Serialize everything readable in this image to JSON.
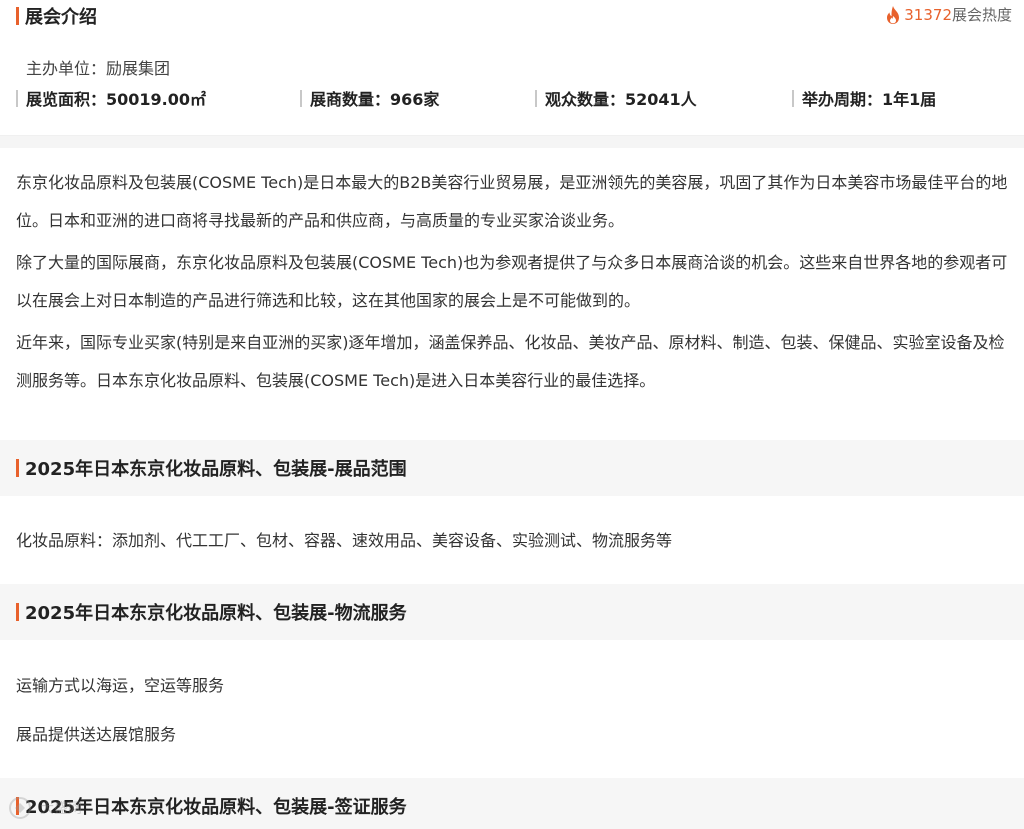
{
  "intro": {
    "title": "展会介绍",
    "heat_value": "31372",
    "heat_label": "展会热度",
    "organizer": "主办单位：励展集团",
    "stats": [
      {
        "label": "展览面积：50019.00㎡"
      },
      {
        "label": "展商数量：966家"
      },
      {
        "label": "观众数量：52041人"
      },
      {
        "label": "举办周期：1年1届"
      }
    ]
  },
  "paragraphs": [
    "东京化妆品原料及包装展(COSME Tech)是日本最大的B2B美容行业贸易展，是亚洲领先的美容展，巩固了其作为日本美容市场最佳平台的地位。日本和亚洲的进口商将寻找最新的产品和供应商，与高质量的专业买家洽谈业务。",
    "除了大量的国际展商，东京化妆品原料及包装展(COSME Tech)也为参观者提供了与众多日本展商洽谈的机会。这些来自世界各地的参观者可以在展会上对日本制造的产品进行筛选和比较，这在其他国家的展会上是不可能做到的。",
    "近年来，国际专业买家(特别是来自亚洲的买家)逐年增加，涵盖保养品、化妆品、美妆产品、原材料、制造、包装、保健品、实验室设备及检测服务等。日本东京化妆品原料、包装展(COSME Tech)是进入日本美容行业的最佳选择。"
  ],
  "sections": [
    {
      "title": "2025年日本东京化妆品原料、包装展-展品范围",
      "lines": [
        "化妆品原料：添加剂、代工工厂、包材、容器、速效用品、美容设备、实验测试、物流服务等"
      ]
    },
    {
      "title": "2025年日本东京化妆品原料、包装展-物流服务",
      "lines": [
        "运输方式以海运，空运等服务",
        "展品提供送达展馆服务"
      ]
    },
    {
      "title": "2025年日本东京化妆品原料、包装展-签证服务",
      "lines": []
    }
  ],
  "watermark": "大盛网",
  "colors": {
    "accent": "#e8612c",
    "section_bg": "#f6f6f6"
  }
}
